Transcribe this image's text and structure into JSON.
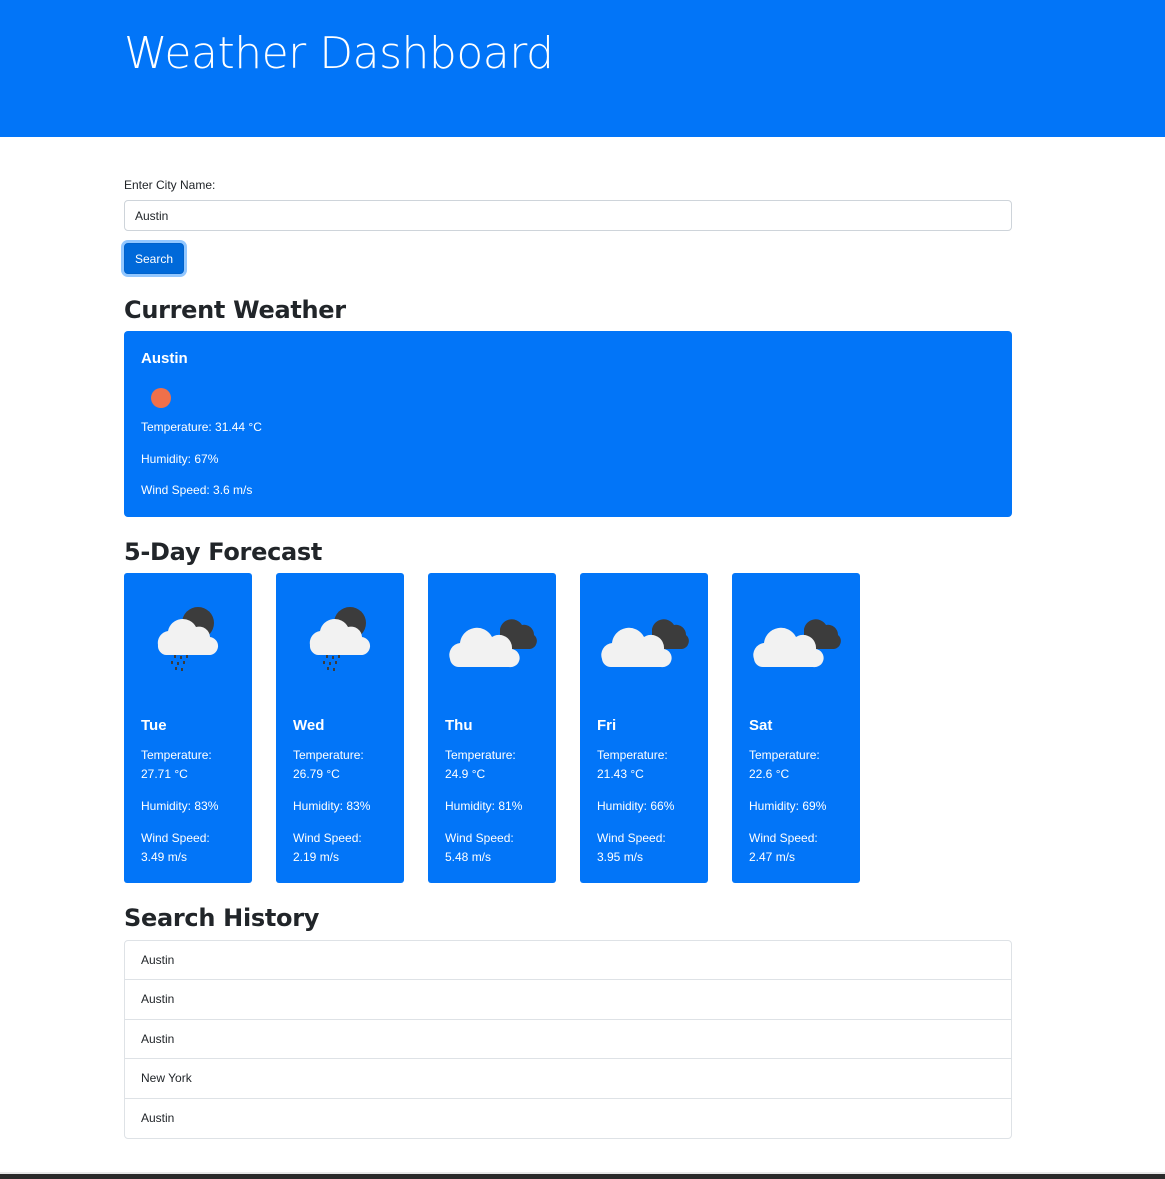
{
  "header": {
    "title": "Weather Dashboard"
  },
  "search": {
    "label": "Enter City Name:",
    "value": "Austin",
    "button_label": "Search"
  },
  "current": {
    "heading": "Current Weather",
    "city": "Austin",
    "icon": "sun-icon",
    "temperature": "Temperature: 31.44 °C",
    "humidity": "Humidity: 67%",
    "wind": "Wind Speed: 3.6 m/s"
  },
  "forecast": {
    "heading": "5-Day Forecast",
    "days": [
      {
        "day": "Tue",
        "icon": "rain-cloud-night-icon",
        "temp_label": "Temperature:",
        "temp": "27.71 °C",
        "humidity": "Humidity: 83%",
        "wind_label": "Wind Speed:",
        "wind": "3.49 m/s"
      },
      {
        "day": "Wed",
        "icon": "rain-cloud-night-icon",
        "temp_label": "Temperature:",
        "temp": "26.79 °C",
        "humidity": "Humidity: 83%",
        "wind_label": "Wind Speed:",
        "wind": "2.19 m/s"
      },
      {
        "day": "Thu",
        "icon": "broken-clouds-icon",
        "temp_label": "Temperature:",
        "temp": "24.9 °C",
        "humidity": "Humidity: 81%",
        "wind_label": "Wind Speed:",
        "wind": "5.48 m/s"
      },
      {
        "day": "Fri",
        "icon": "broken-clouds-icon",
        "temp_label": "Temperature:",
        "temp": "21.43 °C",
        "humidity": "Humidity: 66%",
        "wind_label": "Wind Speed:",
        "wind": "3.95 m/s"
      },
      {
        "day": "Sat",
        "icon": "broken-clouds-icon",
        "temp_label": "Temperature:",
        "temp": "22.6 °C",
        "humidity": "Humidity: 69%",
        "wind_label": "Wind Speed:",
        "wind": "2.47 m/s"
      }
    ]
  },
  "history": {
    "heading": "Search History",
    "items": [
      "Austin",
      "Austin",
      "Austin",
      "New York",
      "Austin"
    ]
  },
  "colors": {
    "primary": "#0275f8",
    "sun": "#f0704a",
    "cloud_light": "#f2f2f2",
    "cloud_dark": "#3c3c3c"
  }
}
